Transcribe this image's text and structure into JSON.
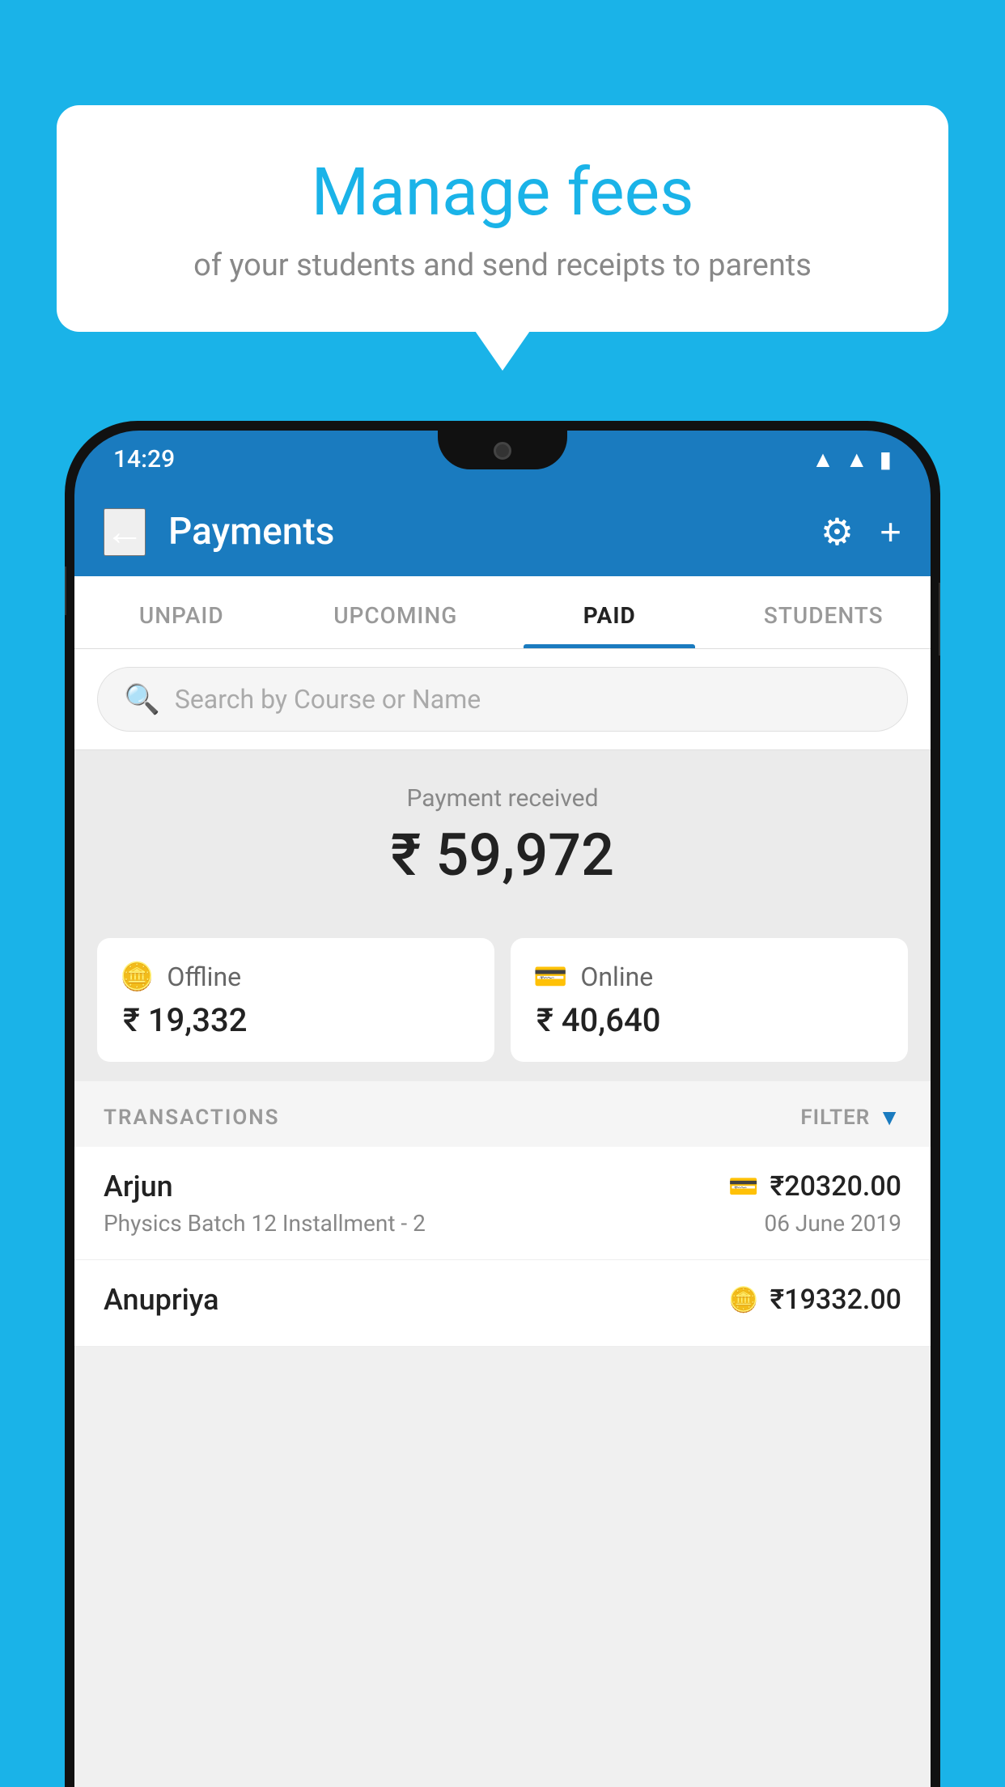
{
  "background_color": "#1ab3e8",
  "bubble": {
    "title": "Manage fees",
    "subtitle": "of your students and send receipts to parents"
  },
  "status_bar": {
    "time": "14:29",
    "icons": [
      "wifi",
      "signal",
      "battery"
    ]
  },
  "header": {
    "title": "Payments",
    "back_label": "←",
    "gear_label": "⚙",
    "plus_label": "+"
  },
  "tabs": [
    {
      "label": "UNPAID",
      "active": false
    },
    {
      "label": "UPCOMING",
      "active": false
    },
    {
      "label": "PAID",
      "active": true
    },
    {
      "label": "STUDENTS",
      "active": false
    }
  ],
  "search": {
    "placeholder": "Search by Course or Name"
  },
  "payment_received": {
    "label": "Payment received",
    "total": "₹ 59,972",
    "offline": {
      "label": "Offline",
      "amount": "₹ 19,332"
    },
    "online": {
      "label": "Online",
      "amount": "₹ 40,640"
    }
  },
  "transactions_header": {
    "label": "TRANSACTIONS",
    "filter_label": "FILTER"
  },
  "transactions": [
    {
      "name": "Arjun",
      "course": "Physics Batch 12 Installment - 2",
      "amount": "₹20320.00",
      "date": "06 June 2019",
      "payment_type": "online"
    },
    {
      "name": "Anupriya",
      "course": "",
      "amount": "₹19332.00",
      "date": "",
      "payment_type": "offline"
    }
  ]
}
